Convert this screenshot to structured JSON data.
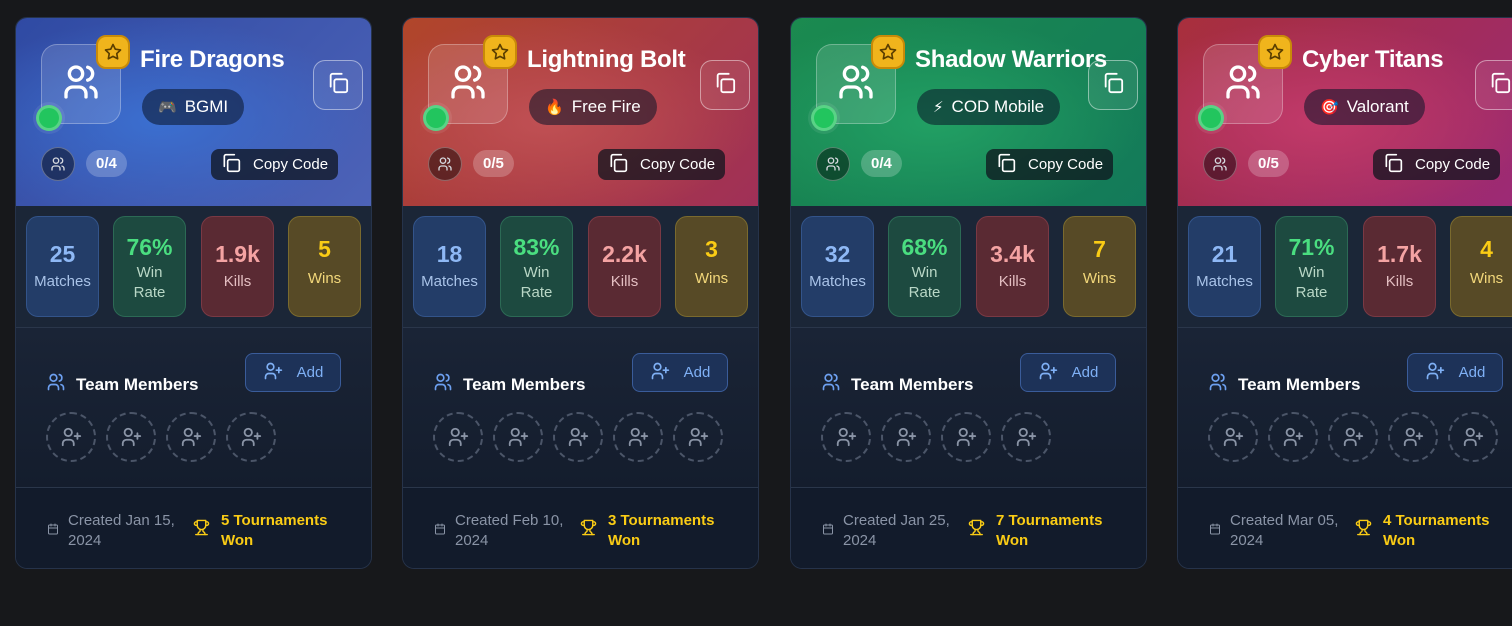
{
  "teams": [
    {
      "name": "Fire Dragons",
      "game": "BGMI",
      "game_icon": "gamepad-icon",
      "game_emoji": "🎮",
      "member_count": "0/4",
      "copy_code_label": "Copy Code",
      "header_gradient": [
        "#2f4aa3",
        "#3b6fd0",
        "#4d63b8"
      ],
      "stats": {
        "matches": "25",
        "matches_label": "Matches",
        "win_rate": "76%",
        "win_rate_label": "Win Rate",
        "kills": "1.9k",
        "kills_label": "Kills",
        "wins": "5",
        "wins_label": "Wins"
      },
      "members_title": "Team Members",
      "add_label": "Add",
      "empty_slots": 4,
      "created": "Created Jan 15, 2024",
      "tournaments": "5 Tournaments Won"
    },
    {
      "name": "Lightning Bolt",
      "game": "Free Fire",
      "game_icon": "fire-icon",
      "game_emoji": "🔥",
      "member_count": "0/5",
      "copy_code_label": "Copy Code",
      "header_gradient": [
        "#b1462a",
        "#c05054",
        "#a03058"
      ],
      "stats": {
        "matches": "18",
        "matches_label": "Matches",
        "win_rate": "83%",
        "win_rate_label": "Win Rate",
        "kills": "2.2k",
        "kills_label": "Kills",
        "wins": "3",
        "wins_label": "Wins"
      },
      "members_title": "Team Members",
      "add_label": "Add",
      "empty_slots": 5,
      "created": "Created Feb 10, 2024",
      "tournaments": "3 Tournaments Won"
    },
    {
      "name": "Shadow Warriors",
      "game": "COD Mobile",
      "game_icon": "lightning-icon",
      "game_emoji": "⚡",
      "member_count": "0/4",
      "copy_code_label": "Copy Code",
      "header_gradient": [
        "#1b8a4f",
        "#22a064",
        "#137a5a"
      ],
      "stats": {
        "matches": "32",
        "matches_label": "Matches",
        "win_rate": "68%",
        "win_rate_label": "Win Rate",
        "kills": "3.4k",
        "kills_label": "Kills",
        "wins": "7",
        "wins_label": "Wins"
      },
      "members_title": "Team Members",
      "add_label": "Add",
      "empty_slots": 4,
      "created": "Created Jan 25, 2024",
      "tournaments": "7 Tournaments Won"
    },
    {
      "name": "Cyber Titans",
      "game": "Valorant",
      "game_icon": "target-icon",
      "game_emoji": "🎯",
      "member_count": "0/5",
      "copy_code_label": "Copy Code",
      "header_gradient": [
        "#a82f3c",
        "#c23a6a",
        "#9c2a78"
      ],
      "stats": {
        "matches": "21",
        "matches_label": "Matches",
        "win_rate": "71%",
        "win_rate_label": "Win Rate",
        "kills": "1.7k",
        "kills_label": "Kills",
        "wins": "4",
        "wins_label": "Wins"
      },
      "members_title": "Team Members",
      "add_label": "Add",
      "empty_slots": 5,
      "created": "Created Mar 05, 2024",
      "tournaments": "4 Tournaments Won"
    }
  ]
}
